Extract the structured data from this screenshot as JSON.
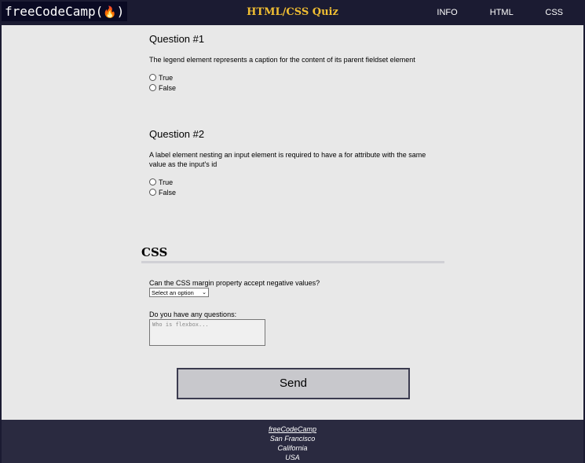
{
  "header": {
    "logo_text": "freeCodeCamp(",
    "logo_end": ")",
    "title": "HTML/CSS Quiz",
    "nav": [
      "INFO",
      "HTML",
      "CSS"
    ]
  },
  "questions": [
    {
      "heading": "Question #1",
      "text": "The legend element represents a caption for the content of its parent fieldset element",
      "options": [
        "True",
        "False"
      ]
    },
    {
      "heading": "Question #2",
      "text": "A label element nesting an input element is required to have a for attribute with the same value as the input's id",
      "options": [
        "True",
        "False"
      ]
    }
  ],
  "css_section": {
    "heading": "CSS",
    "margin_question": "Can the CSS margin property accept negative values?",
    "select_value": "Select an option",
    "questions_label": "Do you have any questions:",
    "textarea_placeholder": "Who is flexbox...",
    "send_label": "Send"
  },
  "footer": {
    "link": "freeCodeCamp",
    "lines": [
      "San Francisco",
      "California",
      "USA"
    ]
  }
}
